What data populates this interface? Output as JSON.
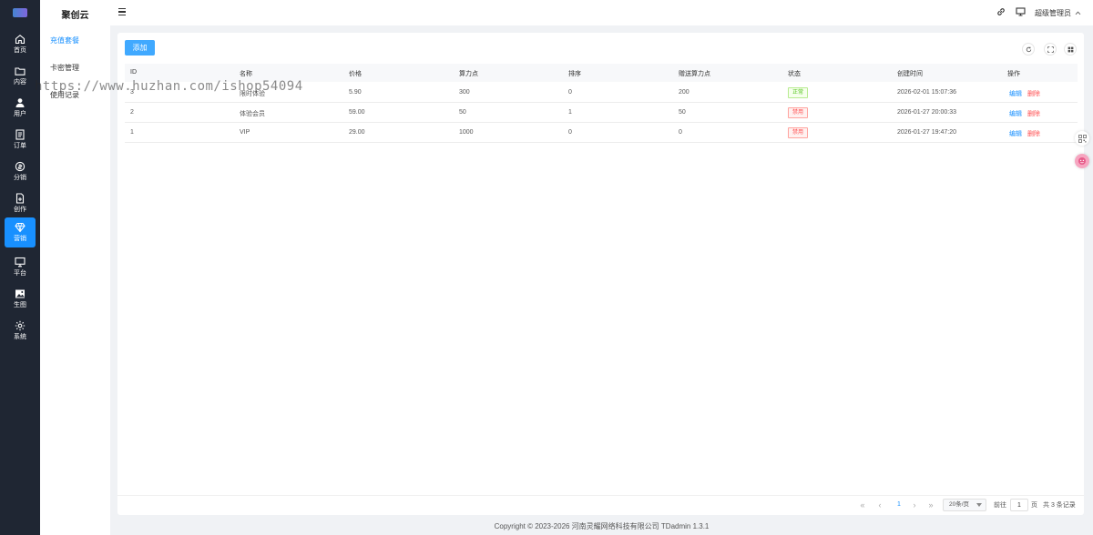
{
  "rail": {
    "items": [
      {
        "label": "首页",
        "icon": "home-icon"
      },
      {
        "label": "内容",
        "icon": "folder-icon"
      },
      {
        "label": "用户",
        "icon": "user-icon"
      },
      {
        "label": "订单",
        "icon": "order-icon"
      },
      {
        "label": "分销",
        "icon": "distribution-icon"
      },
      {
        "label": "创作",
        "icon": "create-icon"
      },
      {
        "label": "营销",
        "icon": "diamond-icon",
        "active": true
      },
      {
        "label": "平台",
        "icon": "monitor-icon"
      },
      {
        "label": "生图",
        "icon": "image-icon"
      },
      {
        "label": "系统",
        "icon": "gear-icon"
      }
    ]
  },
  "subnav": {
    "title": "聚创云",
    "items": [
      {
        "label": "充值套餐",
        "active": true
      },
      {
        "label": "卡密管理"
      },
      {
        "label": "使用记录"
      }
    ]
  },
  "header": {
    "user_name": "超级管理员"
  },
  "toolbar": {
    "add_label": "添加"
  },
  "table": {
    "columns": [
      "ID",
      "名称",
      "价格",
      "算力点",
      "排序",
      "赠送算力点",
      "状态",
      "创建时间",
      "操作"
    ],
    "rows": [
      {
        "id": "3",
        "name": "限时体验",
        "price": "5.90",
        "points": "300",
        "sort": "0",
        "bonus": "200",
        "status": "正常",
        "status_kind": "ok",
        "created": "2026-02-01 15:07:36"
      },
      {
        "id": "2",
        "name": "体验会员",
        "price": "59.00",
        "points": "50",
        "sort": "1",
        "bonus": "50",
        "status": "禁用",
        "status_kind": "off",
        "created": "2026-01-27 20:00:33"
      },
      {
        "id": "1",
        "name": "VIP",
        "price": "29.00",
        "points": "1000",
        "sort": "0",
        "bonus": "0",
        "status": "禁用",
        "status_kind": "off",
        "created": "2026-01-27 19:47:20"
      }
    ],
    "edit_label": "编辑",
    "delete_label": "删除"
  },
  "pagination": {
    "current_page": "1",
    "page_size": "20条/页",
    "goto_label": "前往",
    "goto_value": "1",
    "page_unit": "页",
    "total": "共 3 条记录"
  },
  "footer": {
    "copyright": "Copyright © 2023-2026 河南灵耀网络科技有限公司   TDadmin 1.3.1"
  },
  "watermark": "https://www.huzhan.com/ishop54094",
  "colors": {
    "rail_bg": "#1f2633",
    "accent": "#1890ff",
    "danger": "#ff4d4f",
    "success": "#52c41a"
  }
}
